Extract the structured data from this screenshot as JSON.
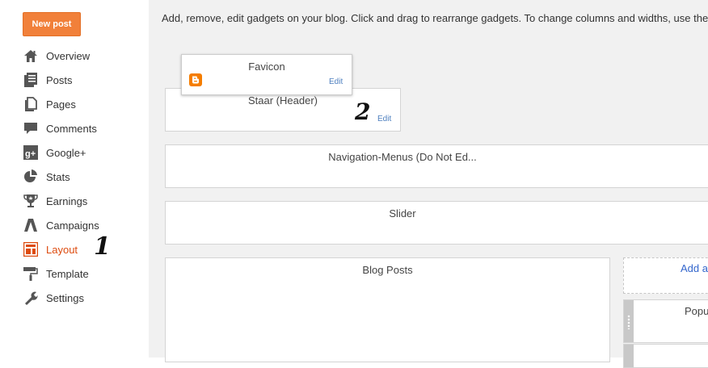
{
  "sidebar": {
    "new_post_label": "New post",
    "items": [
      {
        "label": "Overview",
        "icon": "home-icon"
      },
      {
        "label": "Posts",
        "icon": "posts-icon"
      },
      {
        "label": "Pages",
        "icon": "pages-icon"
      },
      {
        "label": "Comments",
        "icon": "comment-icon"
      },
      {
        "label": "Google+",
        "icon": "google-plus-icon"
      },
      {
        "label": "Stats",
        "icon": "pie-chart-icon"
      },
      {
        "label": "Earnings",
        "icon": "trophy-icon"
      },
      {
        "label": "Campaigns",
        "icon": "campaigns-icon"
      },
      {
        "label": "Layout",
        "icon": "layout-icon",
        "active": true
      },
      {
        "label": "Template",
        "icon": "paint-roller-icon"
      },
      {
        "label": "Settings",
        "icon": "wrench-icon"
      }
    ]
  },
  "annotations": {
    "one": "1",
    "two": "2"
  },
  "main": {
    "description": "Add, remove, edit gadgets on your blog. Click and drag to rearrange gadgets. To change columns and widths, use the",
    "favicon": {
      "title": "Favicon",
      "edit_label": "Edit",
      "icon": "blogger-icon"
    },
    "header": {
      "title": "Staar (Header)",
      "edit_label": "Edit"
    },
    "navigation": {
      "title": "Navigation-Menus (Do Not Ed..."
    },
    "slider": {
      "title": "Slider"
    },
    "blog_posts": {
      "title": "Blog Posts"
    },
    "add_gadget_label": "Add a",
    "popular": {
      "title": "Popu"
    }
  },
  "colors": {
    "accent": "#f1803a",
    "active_nav": "#dd4b0f",
    "link": "#4d7fbf"
  }
}
